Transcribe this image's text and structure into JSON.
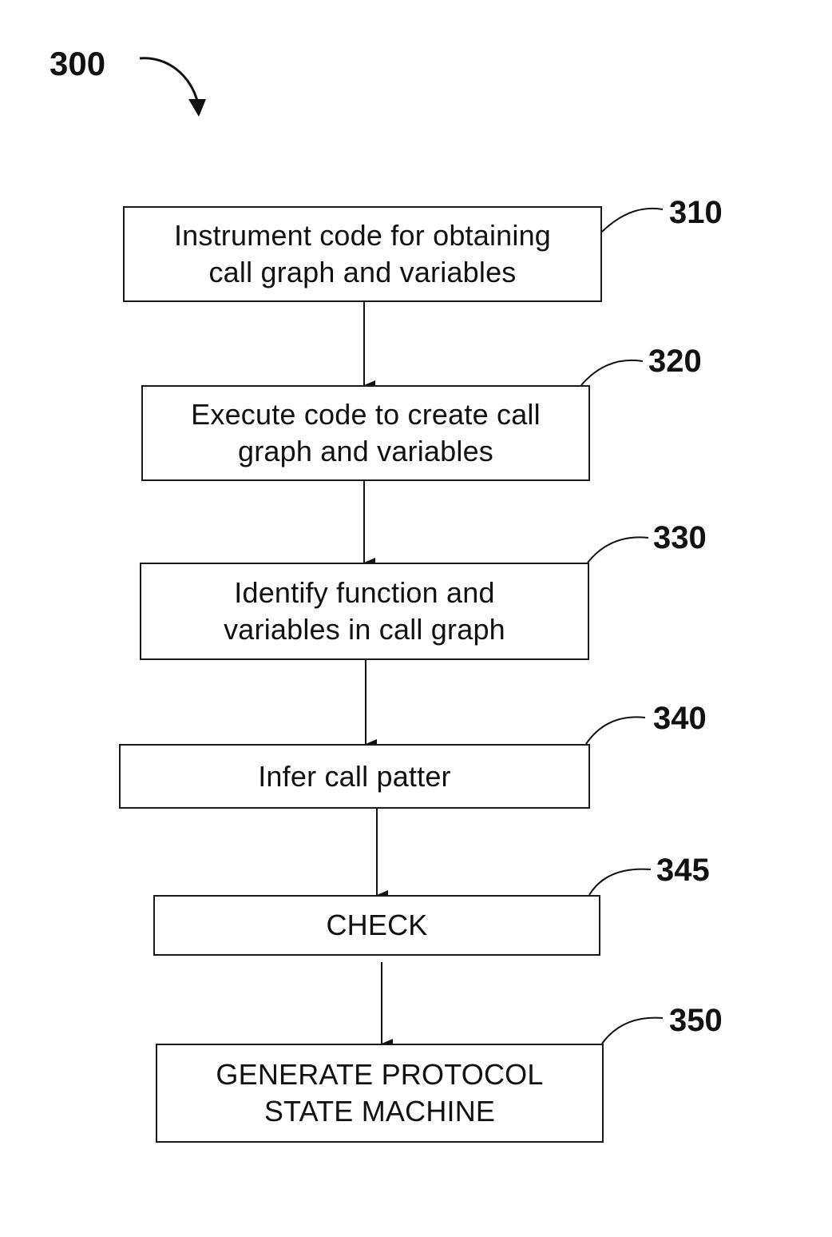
{
  "figure": {
    "reference": "300"
  },
  "steps": [
    {
      "ref": "310",
      "lines": [
        "Instrument code for obtaining",
        "call graph and variables"
      ]
    },
    {
      "ref": "320",
      "lines": [
        "Execute code to create call",
        "graph and variables"
      ]
    },
    {
      "ref": "330",
      "lines": [
        "Identify function and",
        "variables in call graph"
      ]
    },
    {
      "ref": "340",
      "lines": [
        "Infer call patter"
      ]
    },
    {
      "ref": "345",
      "lines": [
        "CHECK"
      ]
    },
    {
      "ref": "350",
      "lines": [
        "GENERATE PROTOCOL",
        "STATE MACHINE"
      ]
    }
  ],
  "connections": [
    {
      "from": "310",
      "to": "320"
    },
    {
      "from": "320",
      "to": "330"
    },
    {
      "from": "330",
      "to": "340"
    },
    {
      "from": "340",
      "to": "345"
    },
    {
      "from": "345",
      "to": "350"
    }
  ]
}
